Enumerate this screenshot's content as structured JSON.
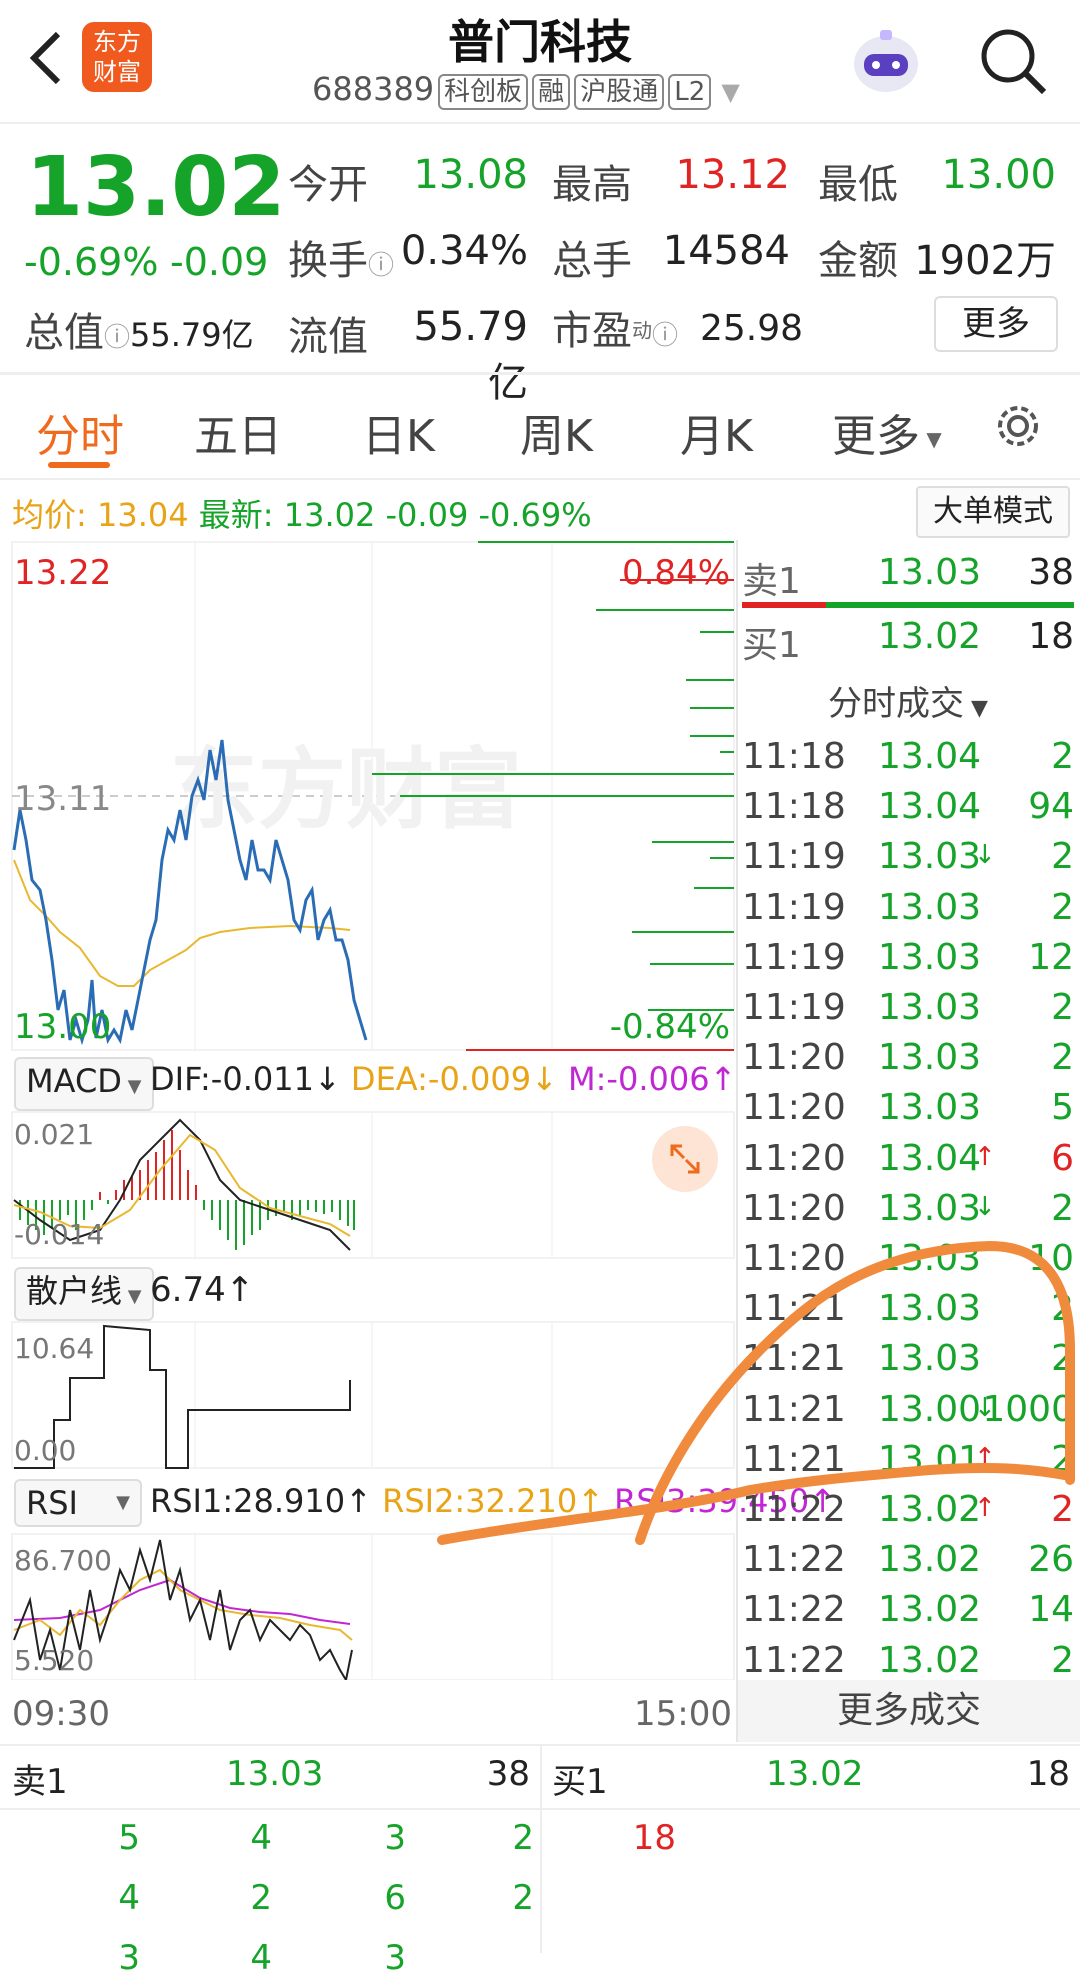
{
  "header": {
    "back_icon": "chevron-left-icon",
    "logo_text_line1": "东方",
    "logo_text_line2": "财富",
    "stock_name": "普门科技",
    "stock_code": "688389",
    "tags": [
      "科创板",
      "融",
      "沪股通",
      "L2"
    ],
    "search_icon": "search-icon"
  },
  "quote": {
    "price": "13.02",
    "change_pct": "-0.69%",
    "change": "-0.09",
    "open_label": "今开",
    "open": "13.08",
    "high_label": "最高",
    "high": "13.12",
    "low_label": "最低",
    "low": "13.00",
    "turnover_label": "换手",
    "turnover": "0.34%",
    "volume_label": "总手",
    "volume": "14584",
    "amount_label": "金额",
    "amount": "1902万",
    "mcap_label": "总值",
    "mcap": "55.79亿",
    "float_label": "流值",
    "float": "55.79亿",
    "pe_label": "市盈",
    "pe_sup": "动",
    "pe": "25.98",
    "more_button": "更多"
  },
  "tabs": [
    "分时",
    "五日",
    "日K",
    "周K",
    "月K",
    "更多"
  ],
  "avg_bar": {
    "avg_label": "均价:",
    "avg": "13.04",
    "latest_label": "最新:",
    "latest": "13.02",
    "change": "-0.09",
    "change_pct": "-0.69%",
    "mode_button": "大单模式"
  },
  "chart": {
    "price_top": "13.22",
    "price_mid": "13.11",
    "price_bottom": "13.00",
    "pct_top": "0.84%",
    "pct_bottom": "-0.84%",
    "watermark": "东方财富",
    "time_start": "09:30",
    "time_end": "15:00"
  },
  "macd": {
    "selector": "MACD",
    "dif": "DIF:-0.011↓",
    "dea": "DEA:-0.009↓",
    "m": "M:-0.006↑",
    "top": "0.021",
    "bottom": "-0.014"
  },
  "retail": {
    "selector": "散户线",
    "value": "6.74↑",
    "top": "10.64",
    "bottom": "0.00"
  },
  "rsi": {
    "selector": "RSI",
    "rsi1": "RSI1:28.910↑",
    "rsi2": "RSI2:32.210↑",
    "rsi3": "RSI3:39.450↑",
    "top": "86.700",
    "bottom": "5.520"
  },
  "orderbook": {
    "sell1_label": "卖1",
    "sell1_price": "13.03",
    "sell1_vol": "38",
    "buy1_label": "买1",
    "buy1_price": "13.02",
    "buy1_vol": "18"
  },
  "trades_header": "分时成交",
  "trades": [
    {
      "time": "11:18",
      "price": "13.04",
      "arrow": "",
      "vol": "2",
      "color": "green"
    },
    {
      "time": "11:18",
      "price": "13.04",
      "arrow": "",
      "vol": "94",
      "color": "green"
    },
    {
      "time": "11:19",
      "price": "13.03",
      "arrow": "↓",
      "vol": "2",
      "color": "green"
    },
    {
      "time": "11:19",
      "price": "13.03",
      "arrow": "",
      "vol": "2",
      "color": "green"
    },
    {
      "time": "11:19",
      "price": "13.03",
      "arrow": "",
      "vol": "12",
      "color": "green"
    },
    {
      "time": "11:19",
      "price": "13.03",
      "arrow": "",
      "vol": "2",
      "color": "green"
    },
    {
      "time": "11:20",
      "price": "13.03",
      "arrow": "",
      "vol": "2",
      "color": "green"
    },
    {
      "time": "11:20",
      "price": "13.03",
      "arrow": "",
      "vol": "5",
      "color": "green"
    },
    {
      "time": "11:20",
      "price": "13.04",
      "arrow": "↑",
      "vol": "6",
      "color": "red"
    },
    {
      "time": "11:20",
      "price": "13.03",
      "arrow": "↓",
      "vol": "2",
      "color": "green"
    },
    {
      "time": "11:20",
      "price": "13.03",
      "arrow": "",
      "vol": "10",
      "color": "green"
    },
    {
      "time": "11:21",
      "price": "13.03",
      "arrow": "",
      "vol": "2",
      "color": "green"
    },
    {
      "time": "11:21",
      "price": "13.03",
      "arrow": "",
      "vol": "2",
      "color": "green"
    },
    {
      "time": "11:21",
      "price": "13.00",
      "arrow": "↓",
      "vol": "1000",
      "color": "green"
    },
    {
      "time": "11:21",
      "price": "13.01",
      "arrow": "↑",
      "vol": "2",
      "color": "green"
    },
    {
      "time": "11:22",
      "price": "13.02",
      "arrow": "↑",
      "vol": "2",
      "color": "red"
    },
    {
      "time": "11:22",
      "price": "13.02",
      "arrow": "",
      "vol": "26",
      "color": "green"
    },
    {
      "time": "11:22",
      "price": "13.02",
      "arrow": "",
      "vol": "14",
      "color": "green"
    },
    {
      "time": "11:22",
      "price": "13.02",
      "arrow": "",
      "vol": "2",
      "color": "green"
    }
  ],
  "more_trades": "更多成交",
  "level_queue": {
    "sell_label": "卖1",
    "sell_price": "13.03",
    "sell_vol": "38",
    "buy_label": "买1",
    "buy_price": "13.02",
    "buy_vol": "18",
    "sell_rows": [
      [
        "5",
        "4",
        "3",
        "2"
      ],
      [
        "4",
        "2",
        "6",
        "2"
      ],
      [
        "3",
        "4",
        "3",
        ""
      ]
    ],
    "buy_rows": [
      [
        "18"
      ]
    ]
  },
  "colors": {
    "up": "#e02424",
    "down": "#16a329",
    "accent": "#f06a1e",
    "avg": "#e8a317",
    "price_line": "#2a6db5"
  }
}
